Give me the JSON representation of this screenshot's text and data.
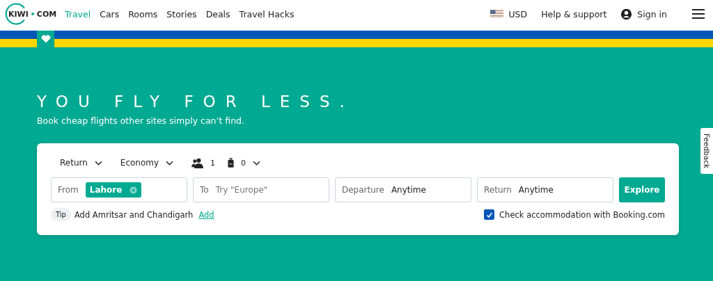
{
  "header": {
    "logo": [
      "KIWI",
      "COM"
    ],
    "nav": [
      {
        "label": "Travel",
        "selected": true
      },
      {
        "label": "Cars",
        "selected": false
      },
      {
        "label": "Rooms",
        "selected": false
      },
      {
        "label": "Stories",
        "selected": false
      },
      {
        "label": "Deals",
        "selected": false
      },
      {
        "label": "Travel Hacks",
        "selected": false
      }
    ],
    "currency": "USD",
    "help": "Help & support",
    "sign_in": "Sign in"
  },
  "hero": {
    "title": "YOU FLY FOR LESS.",
    "subtitle": "Book cheap flights other sites simply can’t find."
  },
  "search": {
    "trip_type": "Return",
    "cabin": "Economy",
    "passengers": "1",
    "bags": "0",
    "fields": [
      {
        "kind": "chip",
        "label": "From",
        "value": "Lahore"
      },
      {
        "kind": "placeholder",
        "label": "To",
        "placeholder": "Try \"Europe\""
      },
      {
        "kind": "value",
        "label": "Departure",
        "value": "Anytime"
      },
      {
        "kind": "value",
        "label": "Return",
        "value": "Anytime"
      }
    ],
    "button": "Explore",
    "tip": {
      "badge": "Tip",
      "text": "Add Amritsar and Chandigarh",
      "link": "Add"
    },
    "accommodation": {
      "label": "Check accommodation with Booking.com",
      "checked": true
    }
  },
  "feedback": "Feedback"
}
